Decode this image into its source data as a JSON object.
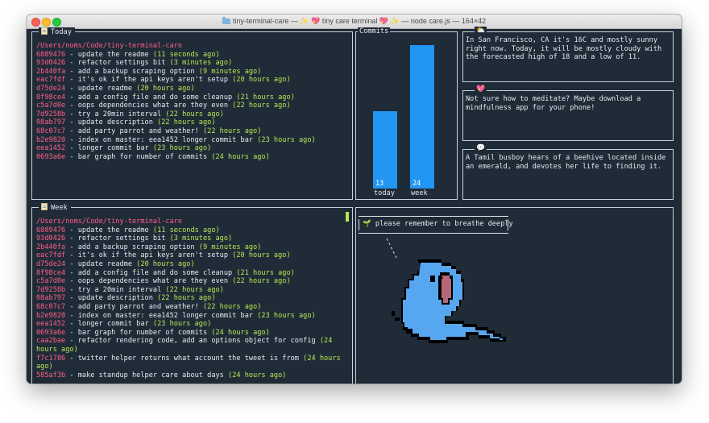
{
  "window": {
    "title_prefix": "tiny-terminal-care —",
    "title_app": "tiny care terminal",
    "title_suffix": "— node care.js — 164×42"
  },
  "today": {
    "label": "Today",
    "path": "/Users/noms/Code/tiny-terminal-care",
    "commits": [
      {
        "hash": "6889476",
        "msg": "update the readme",
        "time": "(11 seconds ago)"
      },
      {
        "hash": "93d0426",
        "msg": "refactor settings bit",
        "time": "(3 minutes ago)"
      },
      {
        "hash": "2b440fa",
        "msg": "add a backup scraping option",
        "time": "(9 minutes ago)"
      },
      {
        "hash": "eac7fdf",
        "msg": "it's ok if the api keys aren't setup",
        "time": "(20 hours ago)"
      },
      {
        "hash": "d75de24",
        "msg": "update readme",
        "time": "(20 hours ago)"
      },
      {
        "hash": "8f98ce4",
        "msg": "add a config file and do some cleanup",
        "time": "(21 hours ago)"
      },
      {
        "hash": "c5a7d0e",
        "msg": "oops dependencies what are they even",
        "time": "(22 hours ago)"
      },
      {
        "hash": "7d9258b",
        "msg": "try a 20min interval",
        "time": "(22 hours ago)"
      },
      {
        "hash": "08ab797",
        "msg": "update description",
        "time": "(22 hours ago)"
      },
      {
        "hash": "68c07c7",
        "msg": "add party parrot and weather!",
        "time": "(22 hours ago)"
      },
      {
        "hash": "b2e9820",
        "msg": "index on master: eea1452 longer commit bar",
        "time": "(23 hours ago)"
      },
      {
        "hash": "eea1452",
        "msg": "longer commit bar",
        "time": "(23 hours ago)"
      },
      {
        "hash": "0693a6e",
        "msg": "bar graph for number of commits",
        "time": "(24 hours ago)"
      }
    ]
  },
  "week": {
    "label": "Week",
    "path": "/Users/noms/Code/tiny-terminal-care",
    "commits": [
      {
        "hash": "6889476",
        "msg": "update the readme",
        "time": "(11 seconds ago)"
      },
      {
        "hash": "93d0426",
        "msg": "refactor settings bit",
        "time": "(3 minutes ago)"
      },
      {
        "hash": "2b440fa",
        "msg": "add a backup scraping option",
        "time": "(9 minutes ago)"
      },
      {
        "hash": "eac7fdf",
        "msg": "it's ok if the api keys aren't setup",
        "time": "(20 hours ago)"
      },
      {
        "hash": "d75de24",
        "msg": "update readme",
        "time": "(20 hours ago)"
      },
      {
        "hash": "8f98ce4",
        "msg": "add a config file and do some cleanup",
        "time": "(21 hours ago)"
      },
      {
        "hash": "c5a7d0e",
        "msg": "oops dependencies what are they even",
        "time": "(22 hours ago)"
      },
      {
        "hash": "7d9258b",
        "msg": "try a 20min interval",
        "time": "(22 hours ago)"
      },
      {
        "hash": "08ab797",
        "msg": "update description",
        "time": "(22 hours ago)"
      },
      {
        "hash": "68c07c7",
        "msg": "add party parrot and weather!",
        "time": "(22 hours ago)"
      },
      {
        "hash": "b2e9820",
        "msg": "index on master: eea1452 longer commit bar",
        "time": "(23 hours ago)"
      },
      {
        "hash": "eea1452",
        "msg": "longer commit bar",
        "time": "(23 hours ago)"
      },
      {
        "hash": "0693a6e",
        "msg": "bar graph for number of commits",
        "time": "(24 hours ago)"
      },
      {
        "hash": "caa2bae",
        "msg": "refactor rendering code, add an options object for config",
        "time": "(24 hours ago)"
      },
      {
        "hash": "f7c1786",
        "msg": "twitter helper returns what account the tweet is from",
        "time": "(24 hours ago)"
      },
      {
        "hash": "585af3b",
        "msg": "make standup helper care about days",
        "time": "(24 hours ago)"
      }
    ]
  },
  "commits_chart": {
    "label": "Commits",
    "chart_data": {
      "type": "bar",
      "categories": [
        "today",
        "week"
      ],
      "values": [
        13,
        24
      ],
      "title": "Commits",
      "ylim": [
        0,
        24
      ]
    }
  },
  "weather": {
    "icon": "sun-cloud-icon",
    "text": "In San Francisco, CA it's 16C and mostly sunny right now. Today, it will be mostly cloudy with the forecasted high of 18 and a low of 11."
  },
  "care": {
    "icon": "heart-icon",
    "text": "Not sure how to meditate? Maybe download a mindfulness app for your phone!"
  },
  "tweet": {
    "icon": "speech-bubble-icon",
    "text": "A Tamil busboy hears of a beehive located inside an emerald, and devotes her life to finding it."
  },
  "parrot": {
    "message": "please remember to breathe deeply"
  },
  "colors": {
    "background": "#202b38",
    "hash": "#ff5f87",
    "time": "#b5e853",
    "bar": "#2196f3",
    "parrot_body": "#56a6f0",
    "parrot_beak": "#b5687a"
  }
}
